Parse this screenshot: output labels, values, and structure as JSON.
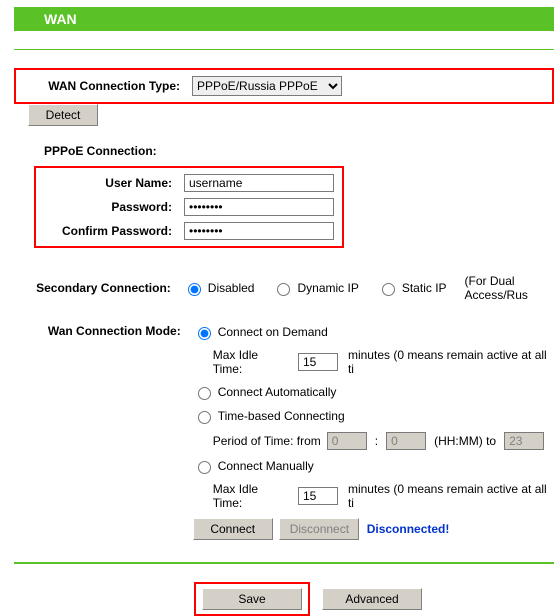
{
  "header": {
    "title": "WAN"
  },
  "wan_type": {
    "label": "WAN Connection Type:",
    "selected": "PPPoE/Russia PPPoE",
    "detect": "Detect"
  },
  "pppoe": {
    "section": "PPPoE Connection:",
    "user_label": "User Name:",
    "user_value": "username",
    "pass_label": "Password:",
    "pass_value": "••••••••",
    "confirm_label": "Confirm Password:",
    "confirm_value": "••••••••"
  },
  "secondary": {
    "label": "Secondary Connection:",
    "disabled": "Disabled",
    "dynamic": "Dynamic IP",
    "static": "Static IP",
    "note": "(For Dual Access/Rus"
  },
  "mode": {
    "label": "Wan Connection Mode:",
    "on_demand": "Connect on Demand",
    "max_idle": "Max Idle Time:",
    "idle1": "15",
    "idle_unit": "minutes (0 means remain active at all ti",
    "auto": "Connect Automatically",
    "timebased": "Time-based Connecting",
    "period": "Period of Time: from",
    "p_from": "0",
    "p_to": "0",
    "hm": "(HH:MM) to",
    "p_end": "23",
    "manual": "Connect Manually",
    "idle2": "15",
    "connect": "Connect",
    "disconnect": "Disconnect",
    "status": "Disconnected!"
  },
  "footer": {
    "save": "Save",
    "advanced": "Advanced"
  }
}
